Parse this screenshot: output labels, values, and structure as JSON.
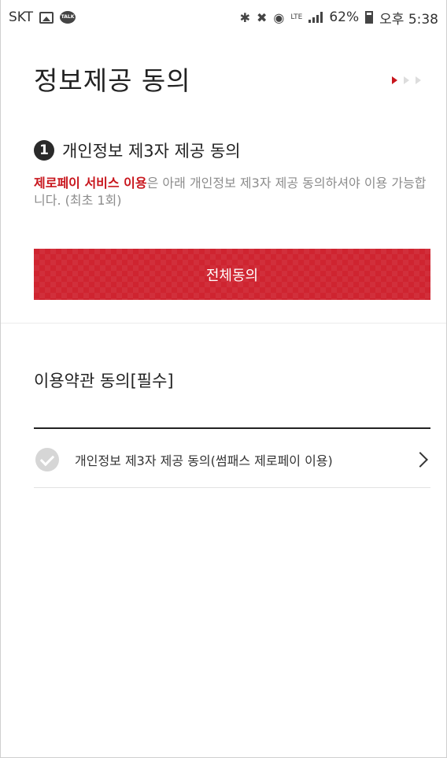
{
  "status_bar": {
    "carrier": "SKT",
    "talk_badge": "TALK",
    "network_label": "LTE",
    "battery": "62%",
    "time": "오후 5:38",
    "icons": [
      "image-icon",
      "talk-icon",
      "bluetooth-icon",
      "mute-icon",
      "alarm-icon",
      "lte-icon",
      "signal-icon",
      "battery-icon"
    ]
  },
  "header": {
    "title": "정보제공 동의",
    "steps_total": 3,
    "step_active": 1
  },
  "section1": {
    "number": "1",
    "title": "개인정보 제3자 제공 동의",
    "desc_highlight": "제로페이 서비스 이용",
    "desc_text": "은 아래 개인정보 제3자 제공 동의하셔야 이용 가능합니다. (최초 1회)",
    "agree_all_label": "전체동의"
  },
  "terms": {
    "title": "이용약관 동의[필수]",
    "items": [
      {
        "label": "개인정보 제3자 제공 동의(썸패스 제로페이 이용)",
        "checked": false
      }
    ]
  },
  "colors": {
    "accent": "#c8161d",
    "button": "#cf2430",
    "muted_text": "#8c8c8c"
  }
}
